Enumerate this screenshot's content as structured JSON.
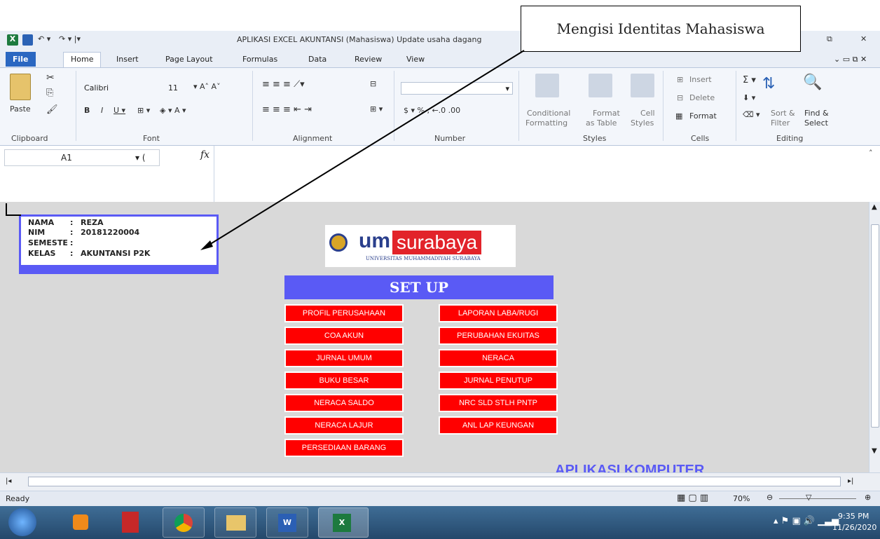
{
  "window": {
    "title": "APLIKASI EXCEL AKUNTANSI (Mahasiswa) Update usaha dagang"
  },
  "tabs": [
    "File",
    "Home",
    "Insert",
    "Page Layout",
    "Formulas",
    "Data",
    "Review",
    "View"
  ],
  "ribbon": {
    "clipboard": {
      "paste": "Paste",
      "group": "Clipboard"
    },
    "font": {
      "name": "Calibri",
      "size": "11",
      "group": "Font"
    },
    "alignment": {
      "group": "Alignment"
    },
    "number": {
      "group": "Number"
    },
    "styles": {
      "conditional_1": "Conditional",
      "conditional_2": "Formatting",
      "format_table_1": "Format",
      "format_table_2": "as Table",
      "cell_styles_1": "Cell",
      "cell_styles_2": "Styles",
      "group": "Styles"
    },
    "cells": {
      "insert": "Insert",
      "delete": "Delete",
      "format": "Format",
      "group": "Cells"
    },
    "editing": {
      "sort_1": "Sort &",
      "sort_2": "Filter",
      "find_1": "Find &",
      "find_2": "Select",
      "group": "Editing"
    }
  },
  "formula_bar": {
    "cell_ref": "A1",
    "fx": "fx"
  },
  "student": {
    "rows": [
      {
        "label": "NAMA",
        "sep": ":",
        "value": "REZA"
      },
      {
        "label": "NIM",
        "sep": ":",
        "value": "20181220004"
      },
      {
        "label": "SEMESTE",
        "sep": ":",
        "value": ""
      },
      {
        "label": "KELAS",
        "sep": ":",
        "value": "AKUNTANSI P2K"
      }
    ]
  },
  "logo": {
    "brand_um": "um",
    "brand_city": "surabaya",
    "subtitle": "UNIVERSITAS MUHAMMADIYAH SURABAYA"
  },
  "setup": {
    "title": "SET UP",
    "left_buttons": [
      "PROFIL PERUSAHAAN",
      "COA AKUN",
      "JURNAL UMUM",
      "BUKU BESAR",
      "NERACA SALDO",
      "NERACA LAJUR",
      "PERSEDIAAN BARANG"
    ],
    "right_buttons": [
      "LAPORAN LABA/RUGI",
      "PERUBAHAN EKUITAS",
      "NERACA",
      "JURNAL PENUTUP",
      "NRC SLD STLH PNTP",
      "ANL LAP KEUNGAN"
    ]
  },
  "footer_title": "APLIKASI KOMPUTER",
  "status": {
    "ready": "Ready",
    "zoom": "70%"
  },
  "taskbar": {
    "time": "9:35 PM",
    "date": "11/26/2020"
  },
  "callout": {
    "text": "Mengisi Identitas Mahasiswa"
  }
}
